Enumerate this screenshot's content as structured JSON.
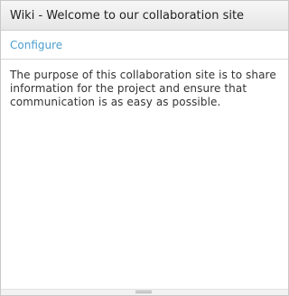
{
  "portlet": {
    "title": "Wiki - Welcome to our collaboration site",
    "configure_label": "Configure",
    "body_text": "The purpose of this collaboration site is to share information for the project and ensure that communication is as easy as possible."
  }
}
